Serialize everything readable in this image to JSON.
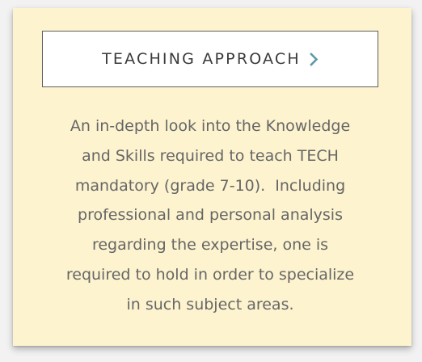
{
  "card": {
    "button_label": "TEACHING APPROACH",
    "button_icon": "chevron-right-icon",
    "accent_color": "#5e9aa6",
    "background_color": "#fdf3cf",
    "description_lines": [
      "An in-depth look into the Knowledge",
      "and Skills required to teach TECH",
      "mandatory (grade 7-10).  Including",
      "professional and personal analysis",
      "regarding the expertise, one is",
      "required to hold in order to specialize",
      "in such subject areas."
    ]
  }
}
